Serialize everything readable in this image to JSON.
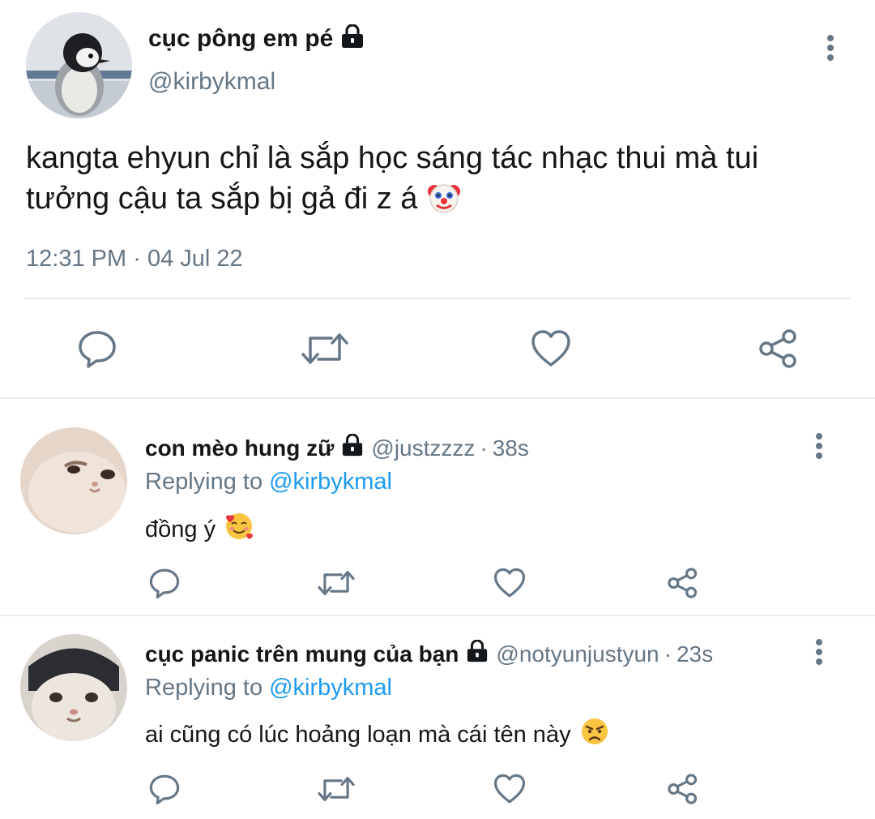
{
  "main_tweet": {
    "display_name": "cục pông em pé",
    "handle": "@kirbykmal",
    "text": "kangta ehyun chỉ là sắp học sáng tác nhạc thui mà tui tưởng cậu ta sắp bị gả đi z á",
    "emoji": "clown-face",
    "time": "12:31 PM",
    "separator": "·",
    "date": "04 Jul 22",
    "locked": true
  },
  "replies": [
    {
      "display_name": "con mèo hung zữ",
      "handle": "@justzzzz",
      "separator": "·",
      "time": "38s",
      "replying_label": "Replying to",
      "replying_to": "@kirbykmal",
      "text": "đồng ý",
      "emoji": "smiling-face-with-hearts",
      "locked": true
    },
    {
      "display_name": "cục panic trên mung của bạn",
      "handle": "@notyunjustyun",
      "separator": "·",
      "time": "23s",
      "replying_label": "Replying to",
      "replying_to": "@kirbykmal",
      "text": "ai cũng có lúc hoảng loạn mà cái tên này",
      "emoji": "angry-face",
      "locked": true
    }
  ],
  "icons": {
    "reply": "reply-icon",
    "retweet": "retweet-icon",
    "like": "heart-icon",
    "share": "share-icon",
    "more": "more-vertical-icon",
    "lock": "lock-icon"
  },
  "colors": {
    "text": "#14171a",
    "secondary": "#657786",
    "link": "#1d9bf0",
    "icon": "#657786",
    "divider": "#e6ecf0"
  }
}
